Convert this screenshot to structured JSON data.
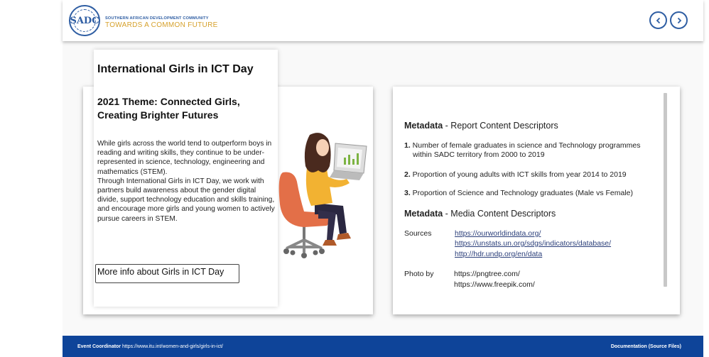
{
  "header": {
    "logo_text": "SADC",
    "org_name": "SOUTHERN AFRICAN DEVELOPMENT COMMUNITY",
    "tagline": "TOWARDS A COMMON FUTURE",
    "prev_icon": "chevron-left-icon",
    "next_icon": "chevron-right-icon",
    "accent": "#2f5ea3"
  },
  "left": {
    "title": "International Girls in ICT Day",
    "theme": "2021 Theme: Connected Girls, Creating Brighter Futures",
    "body": "While girls across the world tend to outperform boys in reading and writing skills, they continue to be under-represented in science, technology, engineering and mathematics (STEM).\nThrough International Girls in ICT Day, we work with partners build awareness about the gender digital divide, support technology education and skills training, and encourage more girls and young women to actively pursue careers in STEM.",
    "button": "More info about Girls in ICT Day"
  },
  "right": {
    "meta1_bold": "Metadata",
    "meta1_rest": " - Report Content Descriptors",
    "items": [
      {
        "num": "1.",
        "line1": " Number of female graduates in science and Technology programmes",
        "line2": "within SADC territory from 2000 to 2019"
      },
      {
        "num": "2.",
        "line1": " Proportion of young adults with ICT skills from year 2014 to 2019"
      },
      {
        "num": "3.",
        "line1": "  Proportion of Science and Technology graduates (Male vs Female)"
      }
    ],
    "meta2_bold": "Metadata",
    "meta2_rest": " - Media Content Descriptors",
    "sources_label": "Sources",
    "sources": [
      "https://ourworldindata.org/",
      "https://unstats.un.org/sdgs/indicators/database/",
      "http://hdr.undp.org/en/data"
    ],
    "photo_label": "Photo by",
    "photos": [
      "https://pngtree.com/",
      "https://www.freepik.com/"
    ]
  },
  "footer": {
    "left_bold": "Event Coordinator",
    "left_url": " https://www.itu.int/women-and-girls/girls-in-ict/",
    "right": "Documentation (Source Files)",
    "color": "#0e4499"
  }
}
